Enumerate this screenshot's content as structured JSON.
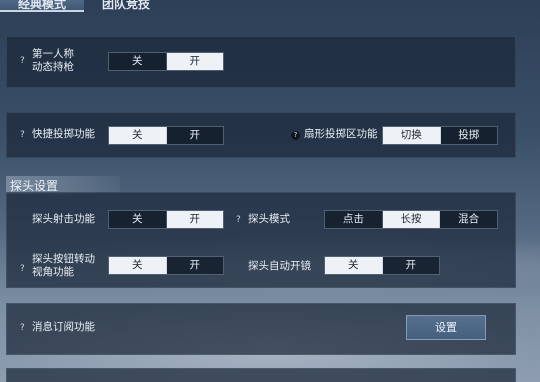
{
  "tabs": [
    {
      "label": "经典模式",
      "active": true
    },
    {
      "label": "团队竞技",
      "active": false
    }
  ],
  "settings": {
    "first_person": {
      "label_line1": "第一人称",
      "label_line2": "动态持枪",
      "options": [
        "关",
        "开"
      ],
      "selected": "开"
    },
    "quick_throw": {
      "label": "快捷投掷功能",
      "options": [
        "关",
        "开"
      ],
      "selected": "关"
    },
    "fan_throw": {
      "label": "扇形投掷区功能",
      "options": [
        "切换",
        "投掷"
      ],
      "selected": "切换"
    }
  },
  "peek_section": {
    "title": "探头设置",
    "peek_shoot": {
      "label": "探头射击功能",
      "options": [
        "关",
        "开"
      ],
      "selected": "开"
    },
    "peek_mode": {
      "label": "探头模式",
      "options": [
        "点击",
        "长按",
        "混合"
      ],
      "selected": "长按"
    },
    "peek_rotate": {
      "label_line1": "探头按钮转动",
      "label_line2": "视角功能",
      "options": [
        "关",
        "开"
      ],
      "selected": "关"
    },
    "peek_auto_scope": {
      "label": "探头自动开镜",
      "options": [
        "关",
        "开"
      ],
      "selected": "关"
    }
  },
  "subscription": {
    "label": "消息订阅功能",
    "button": "设置"
  },
  "help_glyph": "?",
  "colors": {
    "selected_bg": "#eef2f6",
    "panel_bg": "#1c283a",
    "button_bg": "#4c6686"
  }
}
